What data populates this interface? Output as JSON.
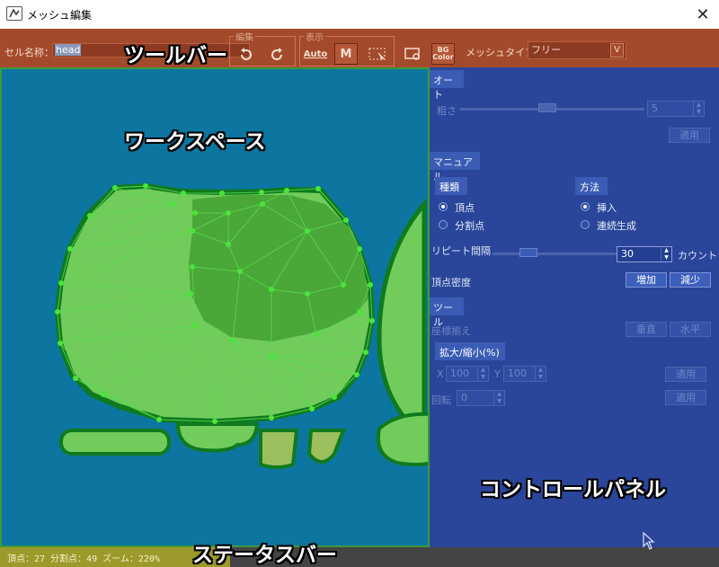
{
  "window": {
    "title": "メッシュ編集",
    "close": "✕"
  },
  "toolbar": {
    "cell_name_label": "セル名称：",
    "cell_name_value": "head",
    "edit_group": "編集",
    "display_group": "表示",
    "undo_icon": "undo-icon",
    "redo_icon": "redo-icon",
    "auto_label": "Auto",
    "manual_label": "M",
    "bg_label": "BG",
    "bg_sub": "Color",
    "mesh_type_label": "メッシュタイプ：",
    "mesh_type_value": "フリー",
    "mesh_type_arrow": "V"
  },
  "panel": {
    "auto": {
      "header": "オート",
      "roughness_label": "粗さ",
      "roughness_value": "5",
      "roughness_fraction": 0.47,
      "apply": "適用"
    },
    "manual": {
      "header": "マニュアル",
      "kind_header": "種類",
      "kind_options": [
        "頂点",
        "分割点"
      ],
      "kind_selected": 0,
      "method_header": "方法",
      "method_options": [
        "挿入",
        "連続生成"
      ],
      "method_selected": 0,
      "repeat_label": "リピート間隔",
      "repeat_value": "30",
      "repeat_fraction": 0.25,
      "count_label": "カウント",
      "density_label": "頂点密度",
      "increase": "増加",
      "decrease": "減少"
    },
    "tools": {
      "header": "ツール",
      "align_label": "座標揃え",
      "vertical": "垂直",
      "horizontal": "水平",
      "scale_header": "拡大/縮小(%)",
      "x_label": "X",
      "x_value": "100",
      "y_label": "Y",
      "y_value": "100",
      "scale_apply": "適用",
      "rotate_label": "回転",
      "rotate_value": "0",
      "rotate_apply": "適用"
    }
  },
  "status": {
    "text": "頂点：27  分割点：49  ズーム：220%"
  },
  "annotations": {
    "toolbar": "ツールバー",
    "workspace": "ワークスペース",
    "control_panel": "コントロールパネル",
    "status_bar": "ステータスバー"
  },
  "colors": {
    "toolbar_bg": "#a44a2c",
    "workspace_bg": "#0c76a0",
    "panel_bg": "#2a469a",
    "mesh_fill": "#78cc5a",
    "mesh_edge": "#56e04a",
    "status_left": "#9c9a2a"
  }
}
